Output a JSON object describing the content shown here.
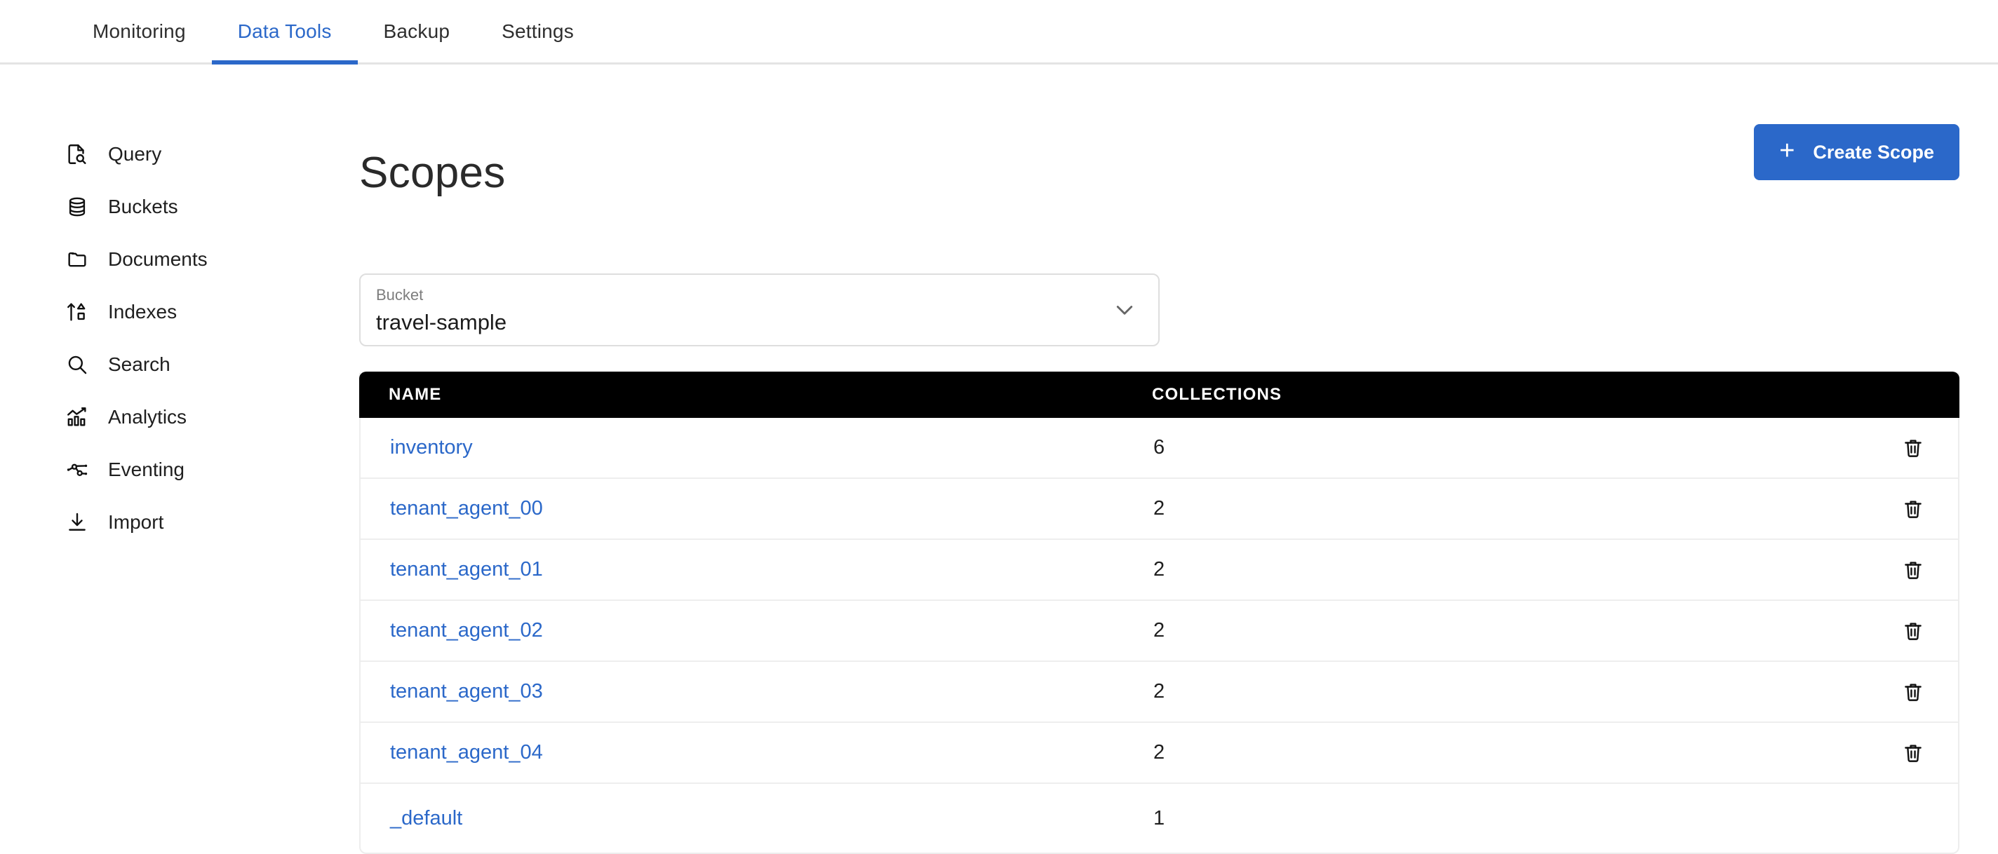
{
  "topbar": {
    "tabs": [
      {
        "label": "Monitoring",
        "active": false
      },
      {
        "label": "Data Tools",
        "active": true
      },
      {
        "label": "Backup",
        "active": false
      },
      {
        "label": "Settings",
        "active": false
      }
    ]
  },
  "sidebar": {
    "items": [
      {
        "label": "Query",
        "icon": "query-icon"
      },
      {
        "label": "Buckets",
        "icon": "buckets-icon"
      },
      {
        "label": "Documents",
        "icon": "documents-icon"
      },
      {
        "label": "Indexes",
        "icon": "indexes-icon"
      },
      {
        "label": "Search",
        "icon": "search-icon"
      },
      {
        "label": "Analytics",
        "icon": "analytics-icon"
      },
      {
        "label": "Eventing",
        "icon": "eventing-icon"
      },
      {
        "label": "Import",
        "icon": "import-icon"
      }
    ]
  },
  "page": {
    "title": "Scopes",
    "create_button": {
      "label": "Create Scope",
      "plus": "+",
      "color": "#2b68c9"
    }
  },
  "bucket_select": {
    "label": "Bucket",
    "value": "travel-sample",
    "chevron_icon": "chevron-down-icon"
  },
  "table": {
    "columns": [
      "NAME",
      "COLLECTIONS"
    ],
    "rows": [
      {
        "name": "inventory",
        "collections": "6",
        "deletable": true
      },
      {
        "name": "tenant_agent_00",
        "collections": "2",
        "deletable": true
      },
      {
        "name": "tenant_agent_01",
        "collections": "2",
        "deletable": true
      },
      {
        "name": "tenant_agent_02",
        "collections": "2",
        "deletable": true
      },
      {
        "name": "tenant_agent_03",
        "collections": "2",
        "deletable": true
      },
      {
        "name": "tenant_agent_04",
        "collections": "2",
        "deletable": true
      },
      {
        "name": "_default",
        "collections": "1",
        "deletable": false
      }
    ],
    "delete_icon": "trash-icon"
  },
  "colors": {
    "accent": "#2b68c9",
    "header_bg": "#000000",
    "link": "#2b68c9",
    "border": "#ededed"
  }
}
